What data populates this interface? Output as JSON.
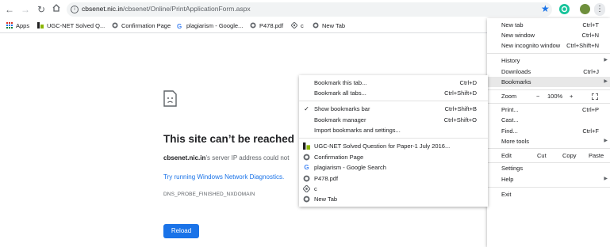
{
  "toolbar": {
    "url_host": "cbsenet.nic.in",
    "url_path": "/cbsenet/Online/PrintApplicationForm.aspx"
  },
  "bookmarks_bar": {
    "apps": "Apps",
    "items": [
      "UGC-NET Solved Q...",
      "Confirmation Page",
      "plagiarism - Google...",
      "P478.pdf",
      "c",
      "New Tab"
    ]
  },
  "error": {
    "title": "This site can’t be reached",
    "host": "cbsenet.nic.in",
    "desc": "’s server IP address could not",
    "link": "Try running Windows Network Diagnostics.",
    "code": "DNS_PROBE_FINISHED_NXDOMAIN",
    "reload": "Reload"
  },
  "menu": {
    "new_tab": "New tab",
    "new_tab_sc": "Ctrl+T",
    "new_window": "New window",
    "new_window_sc": "Ctrl+N",
    "incognito": "New incognito window",
    "incognito_sc": "Ctrl+Shift+N",
    "history": "History",
    "downloads": "Downloads",
    "downloads_sc": "Ctrl+J",
    "bookmarks": "Bookmarks",
    "zoom": "Zoom",
    "zoom_minus": "−",
    "zoom_value": "100%",
    "zoom_plus": "+",
    "print": "Print...",
    "print_sc": "Ctrl+P",
    "cast": "Cast...",
    "find": "Find...",
    "find_sc": "Ctrl+F",
    "more_tools": "More tools",
    "edit": "Edit",
    "cut": "Cut",
    "copy": "Copy",
    "paste": "Paste",
    "settings": "Settings",
    "help": "Help",
    "exit": "Exit"
  },
  "submenu": {
    "bookmark_tab": "Bookmark this tab...",
    "bookmark_tab_sc": "Ctrl+D",
    "bookmark_all": "Bookmark all tabs...",
    "bookmark_all_sc": "Ctrl+Shift+D",
    "show_bar": "Show bookmarks bar",
    "show_bar_sc": "Ctrl+Shift+B",
    "manager": "Bookmark manager",
    "manager_sc": "Ctrl+Shift+O",
    "import": "Import bookmarks and settings...",
    "items": [
      "UGC-NET Solved Question for Paper-1 July 2016...",
      "Confirmation Page",
      "plagiarism - Google Search",
      "P478.pdf",
      "c",
      "New Tab"
    ]
  },
  "colors": {
    "accent": "#1a73e8",
    "highlight": "#e8e8e8"
  }
}
